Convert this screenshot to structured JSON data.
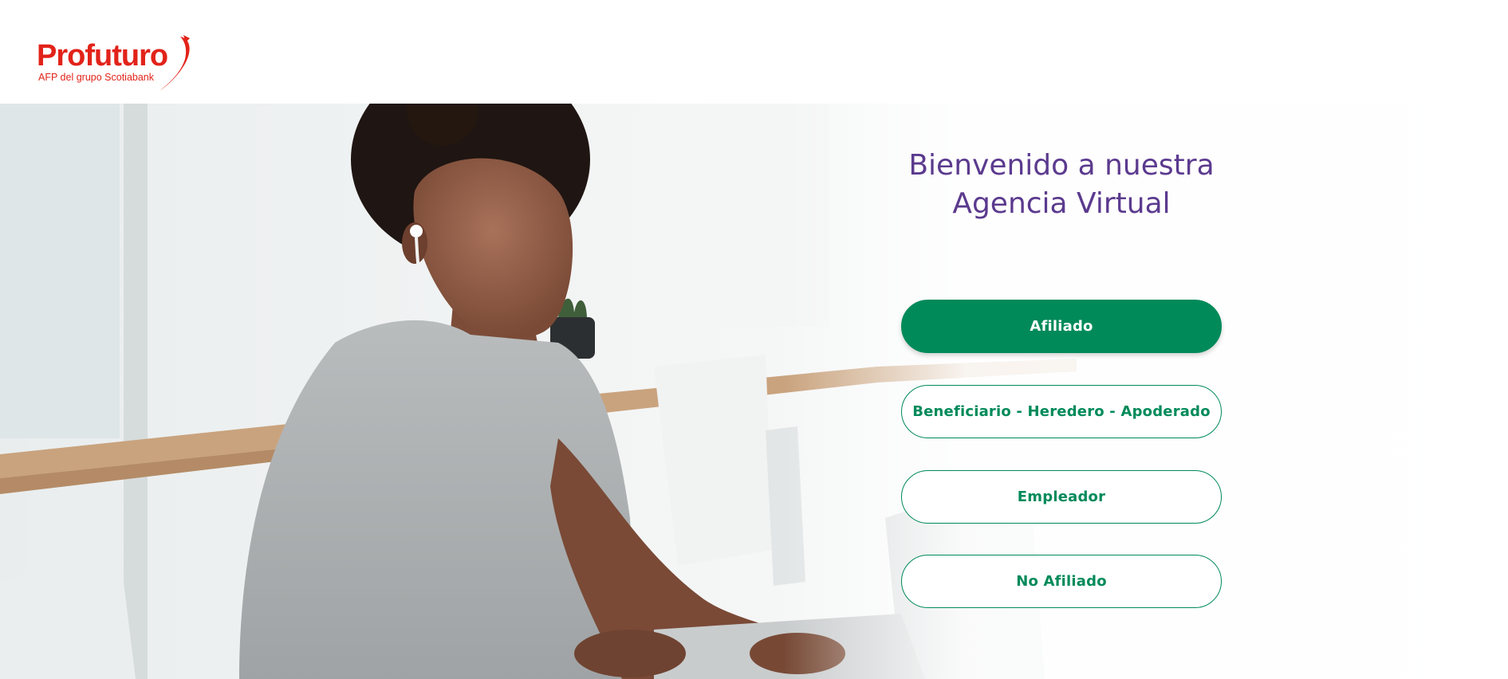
{
  "brand": {
    "name": "Profuturo",
    "tagline": "AFP del grupo Scotiabank",
    "color": "#e2231a"
  },
  "hero": {
    "image_description_icon": "woman-laptop-photo"
  },
  "welcome": {
    "line1": "Bienvenido a nuestra",
    "line2": "Agencia Virtual",
    "color": "#5b3a8e"
  },
  "buttons": {
    "afiliado": "Afiliado",
    "beneficiario": "Beneficiario - Heredero - Apoderado",
    "empleador": "Empleador",
    "no_afiliado": "No Afiliado"
  },
  "accent": "#008a5a"
}
